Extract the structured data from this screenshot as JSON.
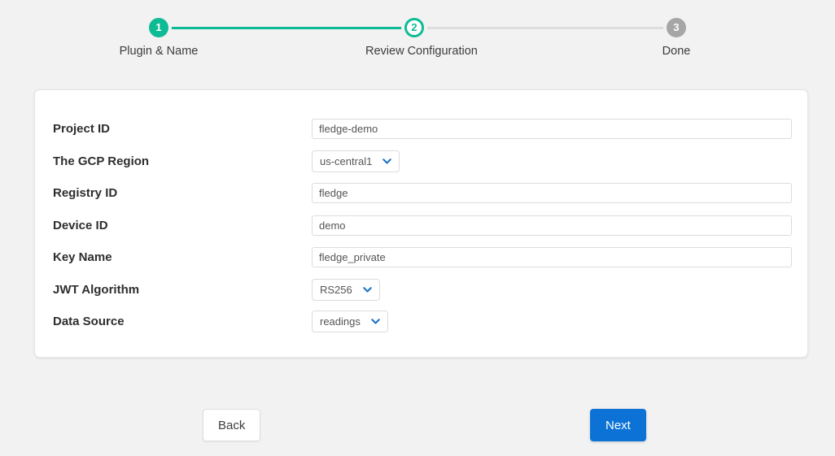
{
  "stepper": {
    "steps": [
      {
        "number": "1",
        "label": "Plugin & Name",
        "state": "completed"
      },
      {
        "number": "2",
        "label": "Review Configuration",
        "state": "current"
      },
      {
        "number": "3",
        "label": "Done",
        "state": "pending"
      }
    ],
    "colors": {
      "completed": "#0dbb95",
      "current": "#0dbb95",
      "pending": "#a6a6a6",
      "track_done": "#0dbb95",
      "track_todo": "#dddddd"
    }
  },
  "form": {
    "fields": [
      {
        "label": "Project ID",
        "type": "text",
        "value": "fledge-demo"
      },
      {
        "label": "The GCP Region",
        "type": "select",
        "value": "us-central1"
      },
      {
        "label": "Registry ID",
        "type": "text",
        "value": "fledge"
      },
      {
        "label": "Device ID",
        "type": "text",
        "value": "demo"
      },
      {
        "label": "Key Name",
        "type": "text",
        "value": "fledge_private"
      },
      {
        "label": "JWT Algorithm",
        "type": "select",
        "value": "RS256"
      },
      {
        "label": "Data Source",
        "type": "select",
        "value": "readings"
      }
    ]
  },
  "actions": {
    "back_label": "Back",
    "next_label": "Next",
    "next_color": "#0c72d6"
  },
  "icons": {
    "chevron_down": "chevron-down-icon",
    "chevron_color": "#1a73c8"
  }
}
